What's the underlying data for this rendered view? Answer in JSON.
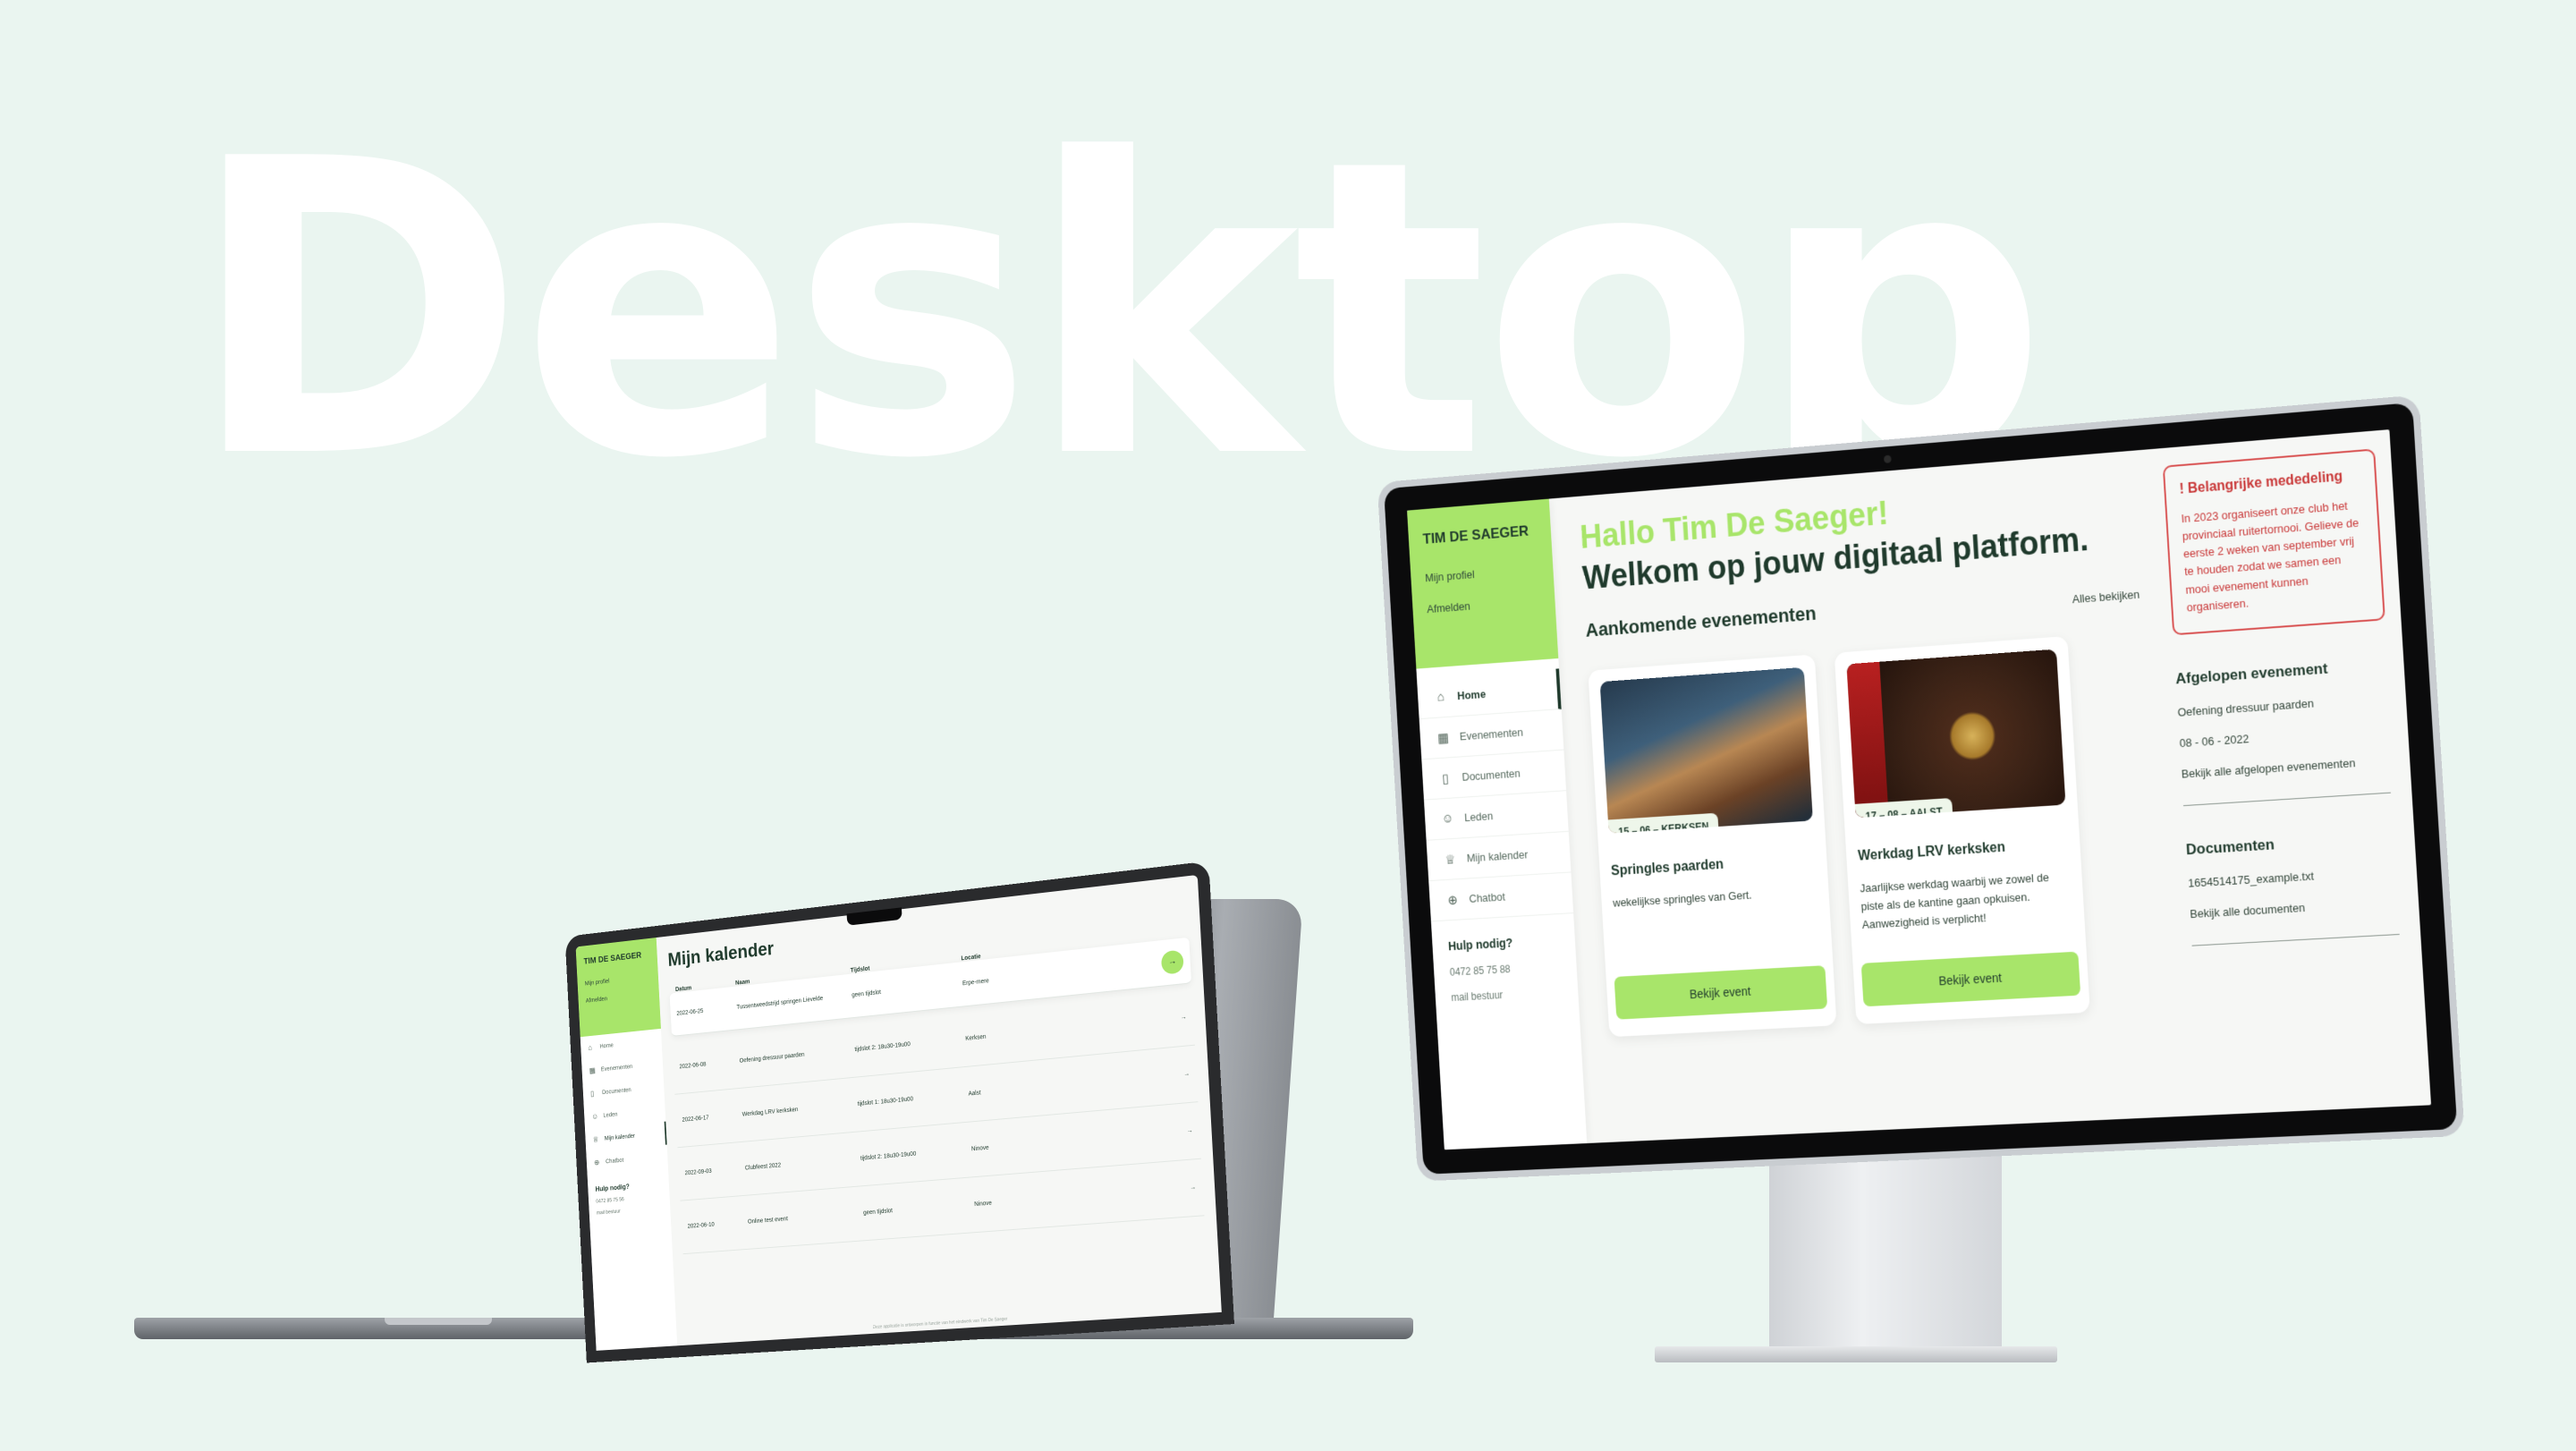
{
  "hero_title": "Desktop",
  "colors": {
    "background": "#eaf5f0",
    "accent": "#a8e56a",
    "dark": "#1f3a2c",
    "alert": "#c93838"
  },
  "dashboard": {
    "brand": "TIM DE SAEGER",
    "top_links": [
      "Mijn profiel",
      "Afmelden"
    ],
    "nav": [
      {
        "icon": "home-icon",
        "label": "Home",
        "active": true
      },
      {
        "icon": "calendar-icon",
        "label": "Evenementen"
      },
      {
        "icon": "document-icon",
        "label": "Documenten"
      },
      {
        "icon": "users-icon",
        "label": "Leden"
      },
      {
        "icon": "trophy-icon",
        "label": "Mijn kalender"
      },
      {
        "icon": "chat-icon",
        "label": "Chatbot"
      }
    ],
    "help": {
      "title": "Hulp nodig?",
      "phone": "0472 85 75 88",
      "mail": "mail bestuur"
    },
    "greeting": "Hallo Tim De Saeger!",
    "welcome": "Welkom op jouw digitaal platform.",
    "events_title": "Aankomende evenementen",
    "see_all": "Alles bekijken",
    "events": [
      {
        "tag": "15 – 06 – KERKSEN",
        "title": "Springles paarden",
        "desc": "wekelijkse springles van Gert.",
        "button": "Bekijk event"
      },
      {
        "tag": "17 – 08 – AALST",
        "title": "Werkdag LRV kerksken",
        "desc": "Jaarlijkse werkdag waarbij we zowel de piste als de kantine gaan opkuisen. Aanwezigheid is verplicht!",
        "button": "Bekijk event"
      }
    ],
    "notice": {
      "title": "! Belangrijke mededeling",
      "text": "In 2023 organiseert onze club het provinciaal ruitertornooi. Gelieve de eerste 2 weken van september vrij te houden zodat we samen een mooi evenement kunnen organiseren."
    },
    "past": {
      "title": "Afgelopen evenement",
      "name": "Oefening dressuur paarden",
      "date": "08 - 06 - 2022",
      "link": "Bekijk alle afgelopen evenementen"
    },
    "documents": {
      "title": "Documenten",
      "file": "1654514175_example.txt",
      "link": "Bekijk alle documenten"
    }
  },
  "calendar": {
    "brand": "TIM DE SAEGER",
    "top_links": [
      "Mijn profiel",
      "Afmelden"
    ],
    "nav": [
      {
        "icon": "home-icon",
        "label": "Home"
      },
      {
        "icon": "calendar-icon",
        "label": "Evenementen"
      },
      {
        "icon": "document-icon",
        "label": "Documenten"
      },
      {
        "icon": "users-icon",
        "label": "Leden"
      },
      {
        "icon": "trophy-icon",
        "label": "Mijn kalender",
        "active": true
      },
      {
        "icon": "chat-icon",
        "label": "Chatbot"
      }
    ],
    "help": {
      "title": "Hulp nodig?",
      "phone": "0472 85 75 56",
      "mail": "mail bestuur"
    },
    "title": "Mijn kalender",
    "headers": [
      "Datum",
      "Naam",
      "Tijdslot",
      "Locatie"
    ],
    "rows": [
      {
        "date": "2022-06-25",
        "name": "Tussentweedstrijd springen Lievelde",
        "slot": "geen tijdslot",
        "location": "Erpe-mere"
      },
      {
        "date": "2022-06-08",
        "name": "Oefening dressuur paarden",
        "slot": "tijdslot 2: 18u30-19u00",
        "location": "Kerksen"
      },
      {
        "date": "2022-06-17",
        "name": "Werkdag LRV kerksken",
        "slot": "tijdslot 1: 18u30-19u00",
        "location": "Aalst"
      },
      {
        "date": "2022-09-03",
        "name": "Clubfeest 2022",
        "slot": "tijdslot 2: 18u30-19u00",
        "location": "Ninove"
      },
      {
        "date": "2022-06-10",
        "name": "Online test event",
        "slot": "geen tijdslot",
        "location": "Ninove"
      }
    ],
    "footer": "Deze applicatie is ontworpen in functie van het eindwerk van Tim De Saeger"
  }
}
